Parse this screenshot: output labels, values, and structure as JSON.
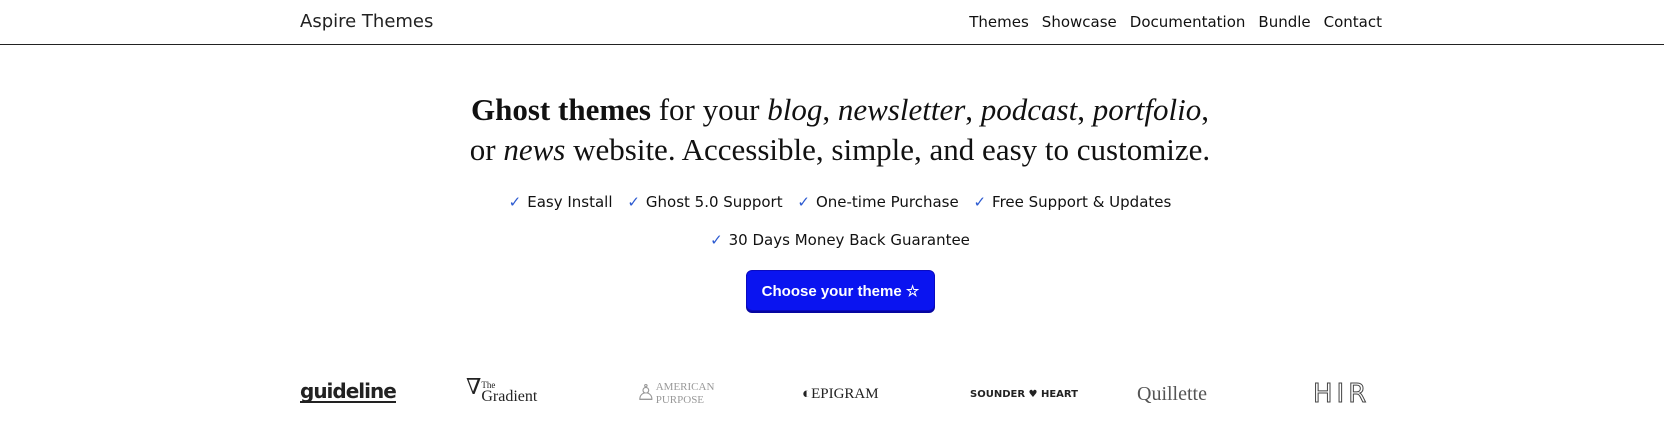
{
  "header": {
    "brand": "Aspire Themes",
    "nav": [
      {
        "label": "Themes"
      },
      {
        "label": "Showcase"
      },
      {
        "label": "Documentation"
      },
      {
        "label": "Bundle"
      },
      {
        "label": "Contact"
      }
    ]
  },
  "hero": {
    "line1": {
      "bold": "Ghost themes",
      "t1": " for your ",
      "i1": "blog",
      "t2": ", ",
      "i2": "newsletter",
      "t3": ", ",
      "i3": "podcast",
      "t4": ", ",
      "i4": "portfolio",
      "t5": ","
    },
    "line2": {
      "t1": "or ",
      "i1": "news",
      "t2": " website. Accessible, simple, and easy to customize."
    },
    "check_glyph": "✓",
    "features": [
      {
        "label": "Easy Install"
      },
      {
        "label": "Ghost 5.0 Support"
      },
      {
        "label": "One-time Purchase"
      },
      {
        "label": "Free Support & Updates"
      }
    ],
    "guarantee": "30  Days Money Back Guarantee",
    "cta_label": "Choose your theme ☆"
  },
  "logos": {
    "guideline": "guideline",
    "gradient_small": "The",
    "gradient_main": "Gradient",
    "american_1": "AMERICAN",
    "american_2": "PURPOSE",
    "epigram": "EPIGRAM",
    "sounder": "SOUNDER ♥ HEART",
    "quillette": "Quillette",
    "hir": "HIR"
  }
}
